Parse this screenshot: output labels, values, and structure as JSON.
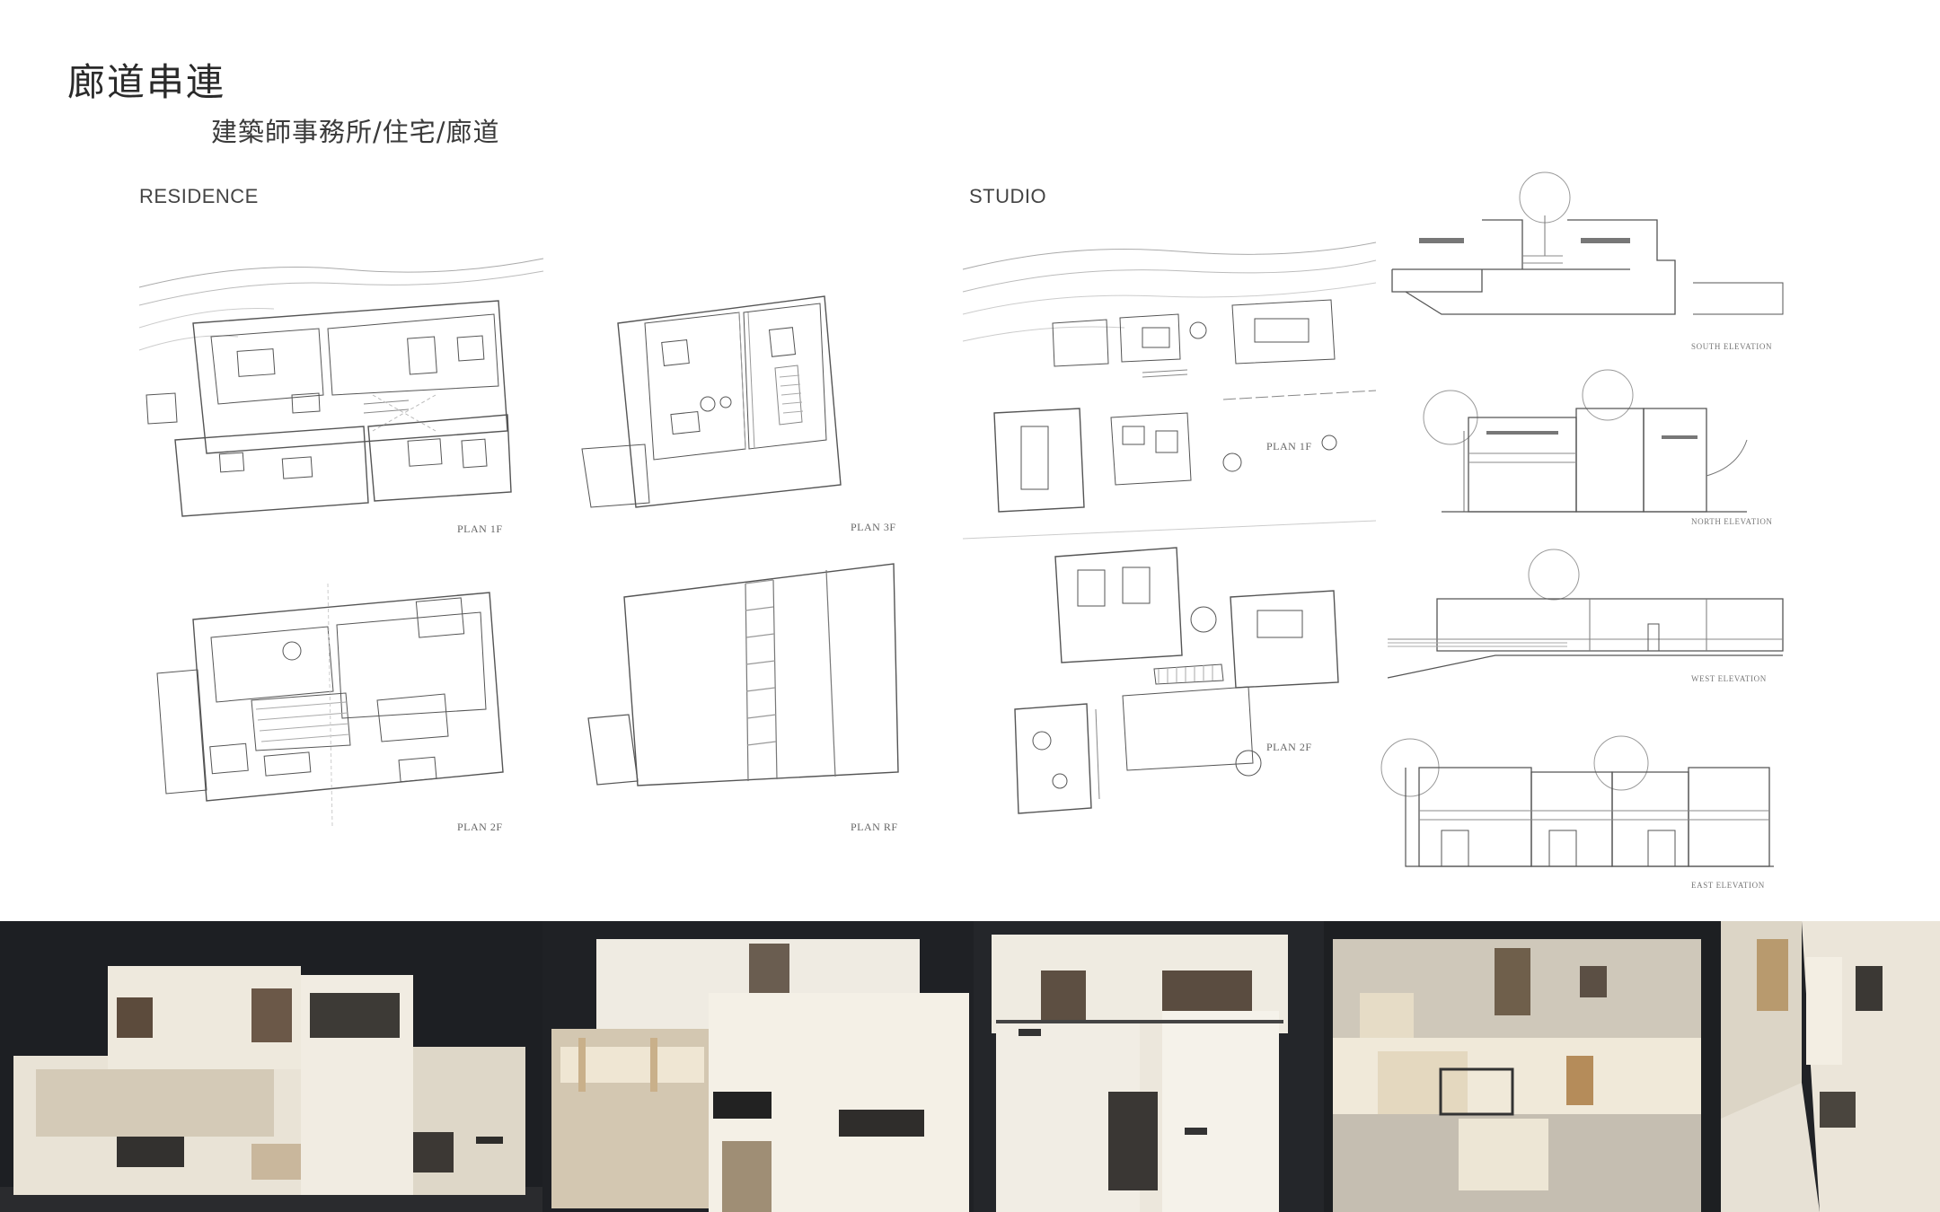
{
  "header": {
    "title": "廊道串連",
    "subtitle": "建築師事務所/住宅/廊道"
  },
  "sections": {
    "residence": "RESIDENCE",
    "studio": "STUDIO"
  },
  "plans": {
    "residence_1f": "PLAN 1F",
    "residence_3f": "PLAN 3F",
    "residence_2f": "PLAN 2F",
    "residence_rf": "PLAN RF",
    "studio_1f": "PLAN 1F",
    "studio_2f": "PLAN 2F"
  },
  "elevations": {
    "south": "SOUTH ELEVATION",
    "north": "NORTH ELEVATION",
    "west": "WEST ELEVATION",
    "east": "EAST ELEVATION"
  },
  "colors": {
    "ink": "#555555",
    "model_paper": "#efe9dc",
    "photo_background": "#1e2024"
  }
}
